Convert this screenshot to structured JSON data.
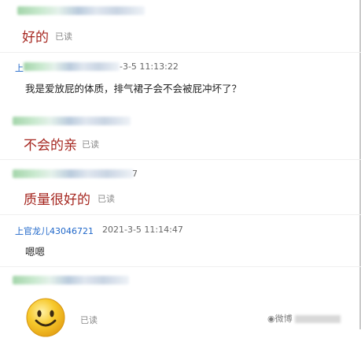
{
  "messages": [
    {
      "reply": "好的",
      "read": "已读"
    },
    {
      "time_suffix": "-3-5 11:13:22",
      "sender_prefix": "上",
      "text": "我是爱放屁的体质，排气裙子会不会被屁冲坏了？"
    },
    {
      "reply": "不会的亲",
      "read": "已读"
    },
    {
      "time_suffix": "7",
      "reply": "质量很好的",
      "read": "已读"
    },
    {
      "sender": "上官龙儿43046721",
      "time": "2021-3-5 11:14:47",
      "text": "嗯嗯"
    },
    {
      "read": "已读"
    }
  ],
  "watermark": {
    "prefix": "微博"
  },
  "colors": {
    "accent_red": "#a5261f",
    "sender_blue": "#1e66c9"
  }
}
